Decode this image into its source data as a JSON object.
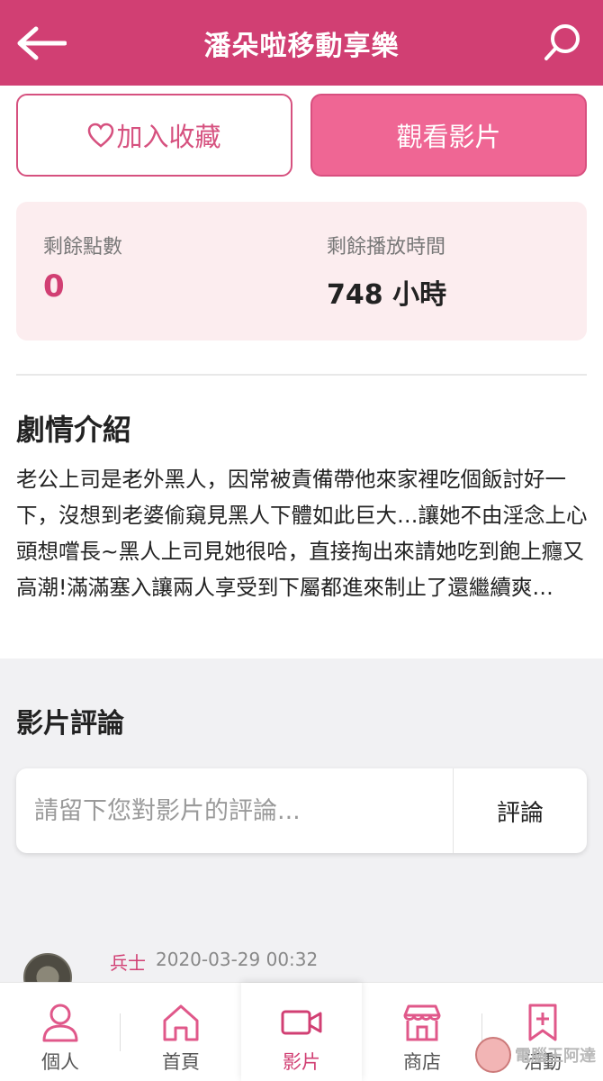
{
  "header": {
    "title": "潘朵啦移動享樂",
    "bg_color": "#d13f73"
  },
  "actions": {
    "favorite_label": "加入收藏",
    "watch_label": "觀看影片"
  },
  "stats": {
    "points_label": "剩餘點數",
    "points_value": "0",
    "time_label": "剩餘播放時間",
    "time_value": "748 小時"
  },
  "plot": {
    "title": "劇情介紹",
    "text": "老公上司是老外黑人，因常被責備帶他來家裡吃個飯討好一下，沒想到老婆偷窺見黑人下體如此巨大…讓她不由淫念上心頭想嚐長~黑人上司見她很哈，直接掏出來請她吃到飽上癮又高潮!滿滿塞入讓兩人享受到下屬都進來制止了還繼續爽…"
  },
  "comments": {
    "title": "影片評論",
    "input_placeholder": "請留下您對影片的評論...",
    "submit_label": "評論",
    "items": [
      {
        "user": "兵士",
        "time": "2020-03-29 00:32"
      }
    ]
  },
  "tabbar": {
    "items": [
      {
        "label": "個人",
        "icon": "person-icon"
      },
      {
        "label": "首頁",
        "icon": "home-icon"
      },
      {
        "label": "影片",
        "icon": "video-camera-icon",
        "active": true
      },
      {
        "label": "商店",
        "icon": "shop-icon"
      },
      {
        "label": "活動",
        "icon": "bookmark-plus-icon"
      }
    ],
    "accent_color": "#d13f73"
  },
  "watermark": {
    "text": "電腦王阿達"
  }
}
